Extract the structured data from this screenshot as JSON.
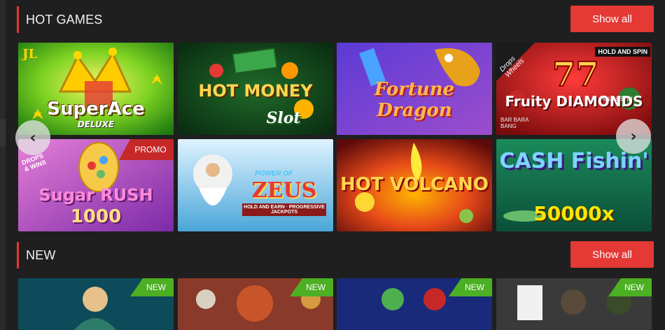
{
  "sections": [
    {
      "title": "HOT GAMES",
      "show_all_label": "Show all",
      "tiles": [
        {
          "name": "SuperAce",
          "subtitle": "DELUXE",
          "corner": "JL",
          "badge": ""
        },
        {
          "name": "HOT MONEY",
          "subtitle": "Slot",
          "corner": "",
          "badge": ""
        },
        {
          "name": "Fortune Dragon",
          "subtitle": "",
          "corner": "",
          "badge": ""
        },
        {
          "name": "Fruity DIAMONDS",
          "subtitle": "HOLD&SPIN",
          "corner": "Drops Wheels",
          "badge": "HOLD AND SPIN",
          "extra": "BAR BARA BANG"
        },
        {
          "name": "Sugar RUSH",
          "subtitle": "1000",
          "corner": "DROPS & WINS",
          "badge": "PROMO"
        },
        {
          "name": "ZEUS",
          "subtitle": "HOLD AND EARN · PROGRESSIVE JACKPOTS",
          "corner": "POWER OF",
          "badge": ""
        },
        {
          "name": "HOT VOLCANO",
          "subtitle": "",
          "corner": "",
          "badge": ""
        },
        {
          "name": "CASH Fishin'",
          "subtitle": "50000x",
          "corner": "",
          "badge": ""
        }
      ]
    },
    {
      "title": "NEW",
      "show_all_label": "Show all",
      "tiles": [
        {
          "badge": "NEW"
        },
        {
          "badge": "NEW"
        },
        {
          "badge": "NEW"
        },
        {
          "badge": "NEW"
        }
      ]
    }
  ],
  "carousel": {
    "prev_icon": "chevron-left-icon",
    "next_icon": "chevron-right-icon",
    "prev_glyph": "‹",
    "next_glyph": "›"
  },
  "colors": {
    "accent": "#e53935",
    "new_badge": "#4caf24",
    "background": "#1f1f1f"
  }
}
